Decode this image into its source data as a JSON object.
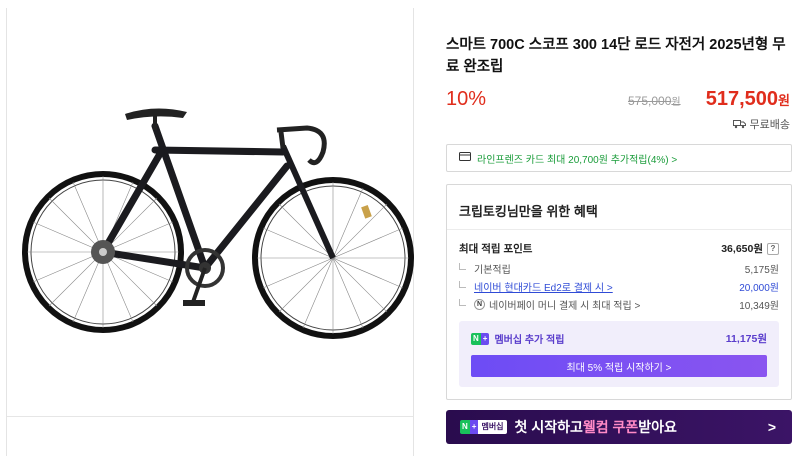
{
  "product": {
    "title": "스마트 700C 스코프 300 14단 로드 자전거 2025년형 무료 완조립",
    "discount": "10%",
    "original_price": "575,000",
    "sale_price": "517,500",
    "currency": "원",
    "shipping": "무료배송"
  },
  "card_promo": {
    "text": "라인프렌즈 카드 최대 20,700원 추가적립(4%) >"
  },
  "benefits": {
    "title": "크립토킹님만을 위한 혜택",
    "max_points_label": "최대 적립 포인트",
    "max_points_value": "36,650원",
    "help": "?",
    "rows": [
      {
        "label": "기본적립",
        "value": "5,175원"
      },
      {
        "label": "네이버 현대카드 Ed2로 결제 시 >",
        "value": "20,000원"
      },
      {
        "label": "네이버페이 머니 결제 시 최대 적립 >",
        "value": "10,349원"
      }
    ],
    "membership": {
      "badge_n": "N",
      "badge_plus": "+",
      "label": "멤버십 추가 적립",
      "value": "11,175원",
      "button": "최대 5% 적립 시작하기 >"
    }
  },
  "banner": {
    "badge_n": "N",
    "badge_plus": "+",
    "badge_text": "멤버십",
    "text_prefix": "첫 시작하고 ",
    "text_highlight": "웰컴 쿠폰",
    "text_suffix": " 받아요",
    "arrow": ">"
  },
  "colors": {
    "price_red": "#e02d1c",
    "green": "#1a9c3a",
    "link_blue": "#2f4bd6",
    "membership_purple": "#6d4cf5",
    "banner_bg": "#2a0c4e"
  }
}
